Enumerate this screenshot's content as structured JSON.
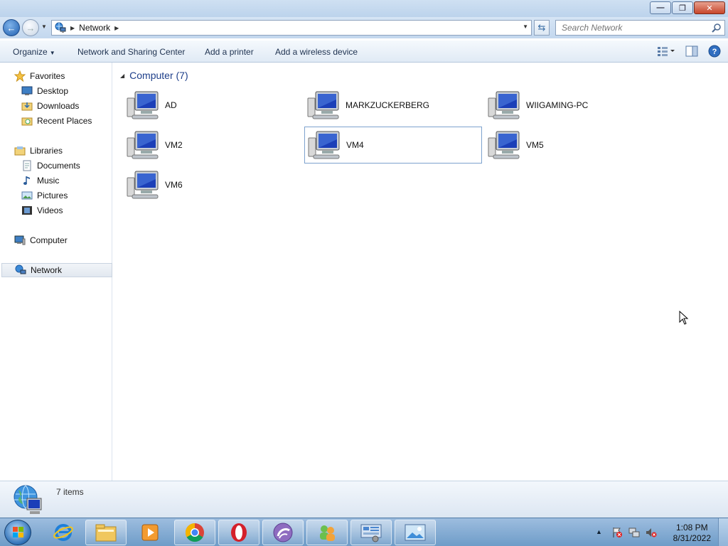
{
  "window": {
    "minimize_glyph": "—",
    "maximize_glyph": "❐",
    "close_glyph": "✕"
  },
  "nav": {
    "back_glyph": "←",
    "forward_glyph": "→",
    "address_location": "Network",
    "search_placeholder": "Search Network"
  },
  "toolbar": {
    "organize": "Organize",
    "network_sharing": "Network and Sharing Center",
    "add_printer": "Add a printer",
    "add_wireless": "Add a wireless device"
  },
  "sidebar": {
    "favorites": "Favorites",
    "desktop": "Desktop",
    "downloads": "Downloads",
    "recent_places": "Recent Places",
    "libraries": "Libraries",
    "documents": "Documents",
    "music": "Music",
    "pictures": "Pictures",
    "videos": "Videos",
    "computer": "Computer",
    "network": "Network"
  },
  "content": {
    "group_header": "Computer (7)",
    "computers": [
      {
        "name": "AD"
      },
      {
        "name": "MARKZUCKERBERG"
      },
      {
        "name": "WIIGAMING-PC"
      },
      {
        "name": "VM2"
      },
      {
        "name": "VM4",
        "selected": true
      },
      {
        "name": "VM5"
      },
      {
        "name": "VM6"
      }
    ]
  },
  "status": {
    "item_count": "7 items"
  },
  "taskbar": {
    "time": "1:08 PM",
    "date": "8/31/2022"
  },
  "colors": {
    "accent": "#1e3f8a",
    "selection_border": "#7da2ce",
    "taskbar": "#6e9cc8"
  }
}
